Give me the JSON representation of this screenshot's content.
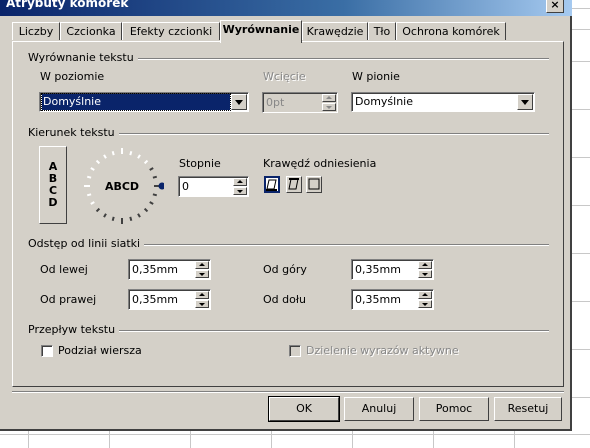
{
  "window": {
    "title": "Atrybuty komórek",
    "close_label": "×"
  },
  "tabs": [
    {
      "label": "Liczby",
      "active": false
    },
    {
      "label": "Czcionka",
      "active": false
    },
    {
      "label": "Efekty czcionki",
      "active": false
    },
    {
      "label": "Wyrównanie",
      "active": true
    },
    {
      "label": "Krawędzie",
      "active": false
    },
    {
      "label": "Tło",
      "active": false
    },
    {
      "label": "Ochrona komórek",
      "active": false
    }
  ],
  "text_alignment": {
    "heading": "Wyrównanie tekstu",
    "horizontal_label": "W poziomie",
    "horizontal_value": "Domyślnie",
    "indent_label": "Wcięcie",
    "indent_value": "0pt",
    "vertical_label": "W pionie",
    "vertical_value": "Domyślnie"
  },
  "text_direction": {
    "heading": "Kierunek tekstu",
    "vertical_stack": [
      "A",
      "B",
      "C",
      "D"
    ],
    "dial_text": "ABCD",
    "degrees_label": "Stopnie",
    "degrees_value": "0",
    "reference_edge_label": "Krawędź odniesienia",
    "reference_edge_options": [
      "bottom-edge-icon",
      "top-edge-icon",
      "inside-cell-icon"
    ],
    "reference_edge_selected": 0
  },
  "grid_spacing": {
    "heading": "Odstęp od linii siatki",
    "left_label": "Od lewej",
    "left_value": "0,35mm",
    "right_label": "Od prawej",
    "right_value": "0,35mm",
    "top_label": "Od góry",
    "top_value": "0,35mm",
    "bottom_label": "Od dołu",
    "bottom_value": "0,35mm"
  },
  "text_flow": {
    "heading": "Przepływ tekstu",
    "wrap_label": "Podział wiersza",
    "wrap_checked": false,
    "hyphenation_label": "Dzielenie wyrazów aktywne",
    "hyphenation_checked": false,
    "hyphenation_enabled": false
  },
  "buttons": {
    "ok": "OK",
    "cancel": "Anuluj",
    "help": "Pomoc",
    "reset": "Resetuj"
  },
  "colors": {
    "titlebar": "#0a246a",
    "dialog_bg": "#d4d0c8",
    "selection": "#0a246a",
    "dial_marker": "#0a246a"
  }
}
